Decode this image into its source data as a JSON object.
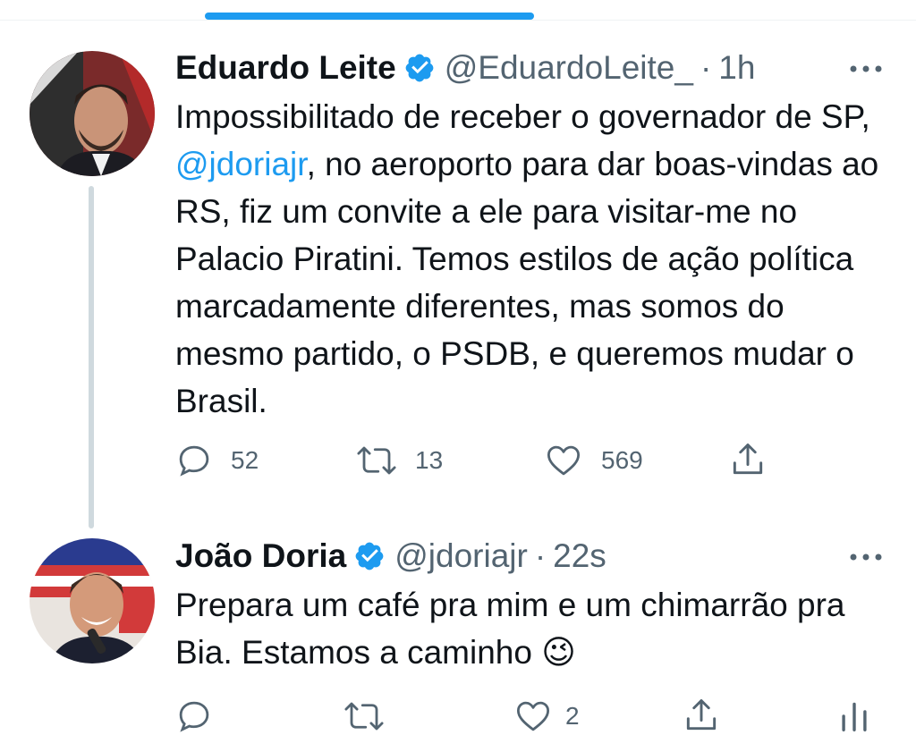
{
  "thread": {
    "tweets": [
      {
        "name": "Eduardo Leite",
        "handle": "@EduardoLeite_",
        "separator": "·",
        "time": "1h",
        "text_parts": [
          "Impossibilitado de receber o governador de SP, ",
          "@jdoriajr",
          ", no aeroporto para dar boas-vindas ao RS, fiz um convite a ele para visitar-me no Palacio Piratini. Temos estilos de ação política marcadamente diferentes, mas somos do mesmo partido, o PSDB, e queremos mudar o Brasil."
        ],
        "replies": "52",
        "retweets": "13",
        "likes": "569"
      },
      {
        "name": "João Doria",
        "handle": "@jdoriajr",
        "separator": "·",
        "time": "22s",
        "text": "Prepara um café pra mim e um chimarrão pra Bia. Estamos a caminho 😉",
        "replies": "",
        "retweets": "",
        "likes": "2"
      }
    ]
  },
  "colors": {
    "accent": "#1d9bf0",
    "text": "#0f1419",
    "secondary": "#536471",
    "line": "#cfd9de"
  },
  "icons": [
    "verified-badge-icon",
    "more-icon",
    "reply-icon",
    "retweet-icon",
    "like-icon",
    "share-icon",
    "analytics-icon"
  ]
}
